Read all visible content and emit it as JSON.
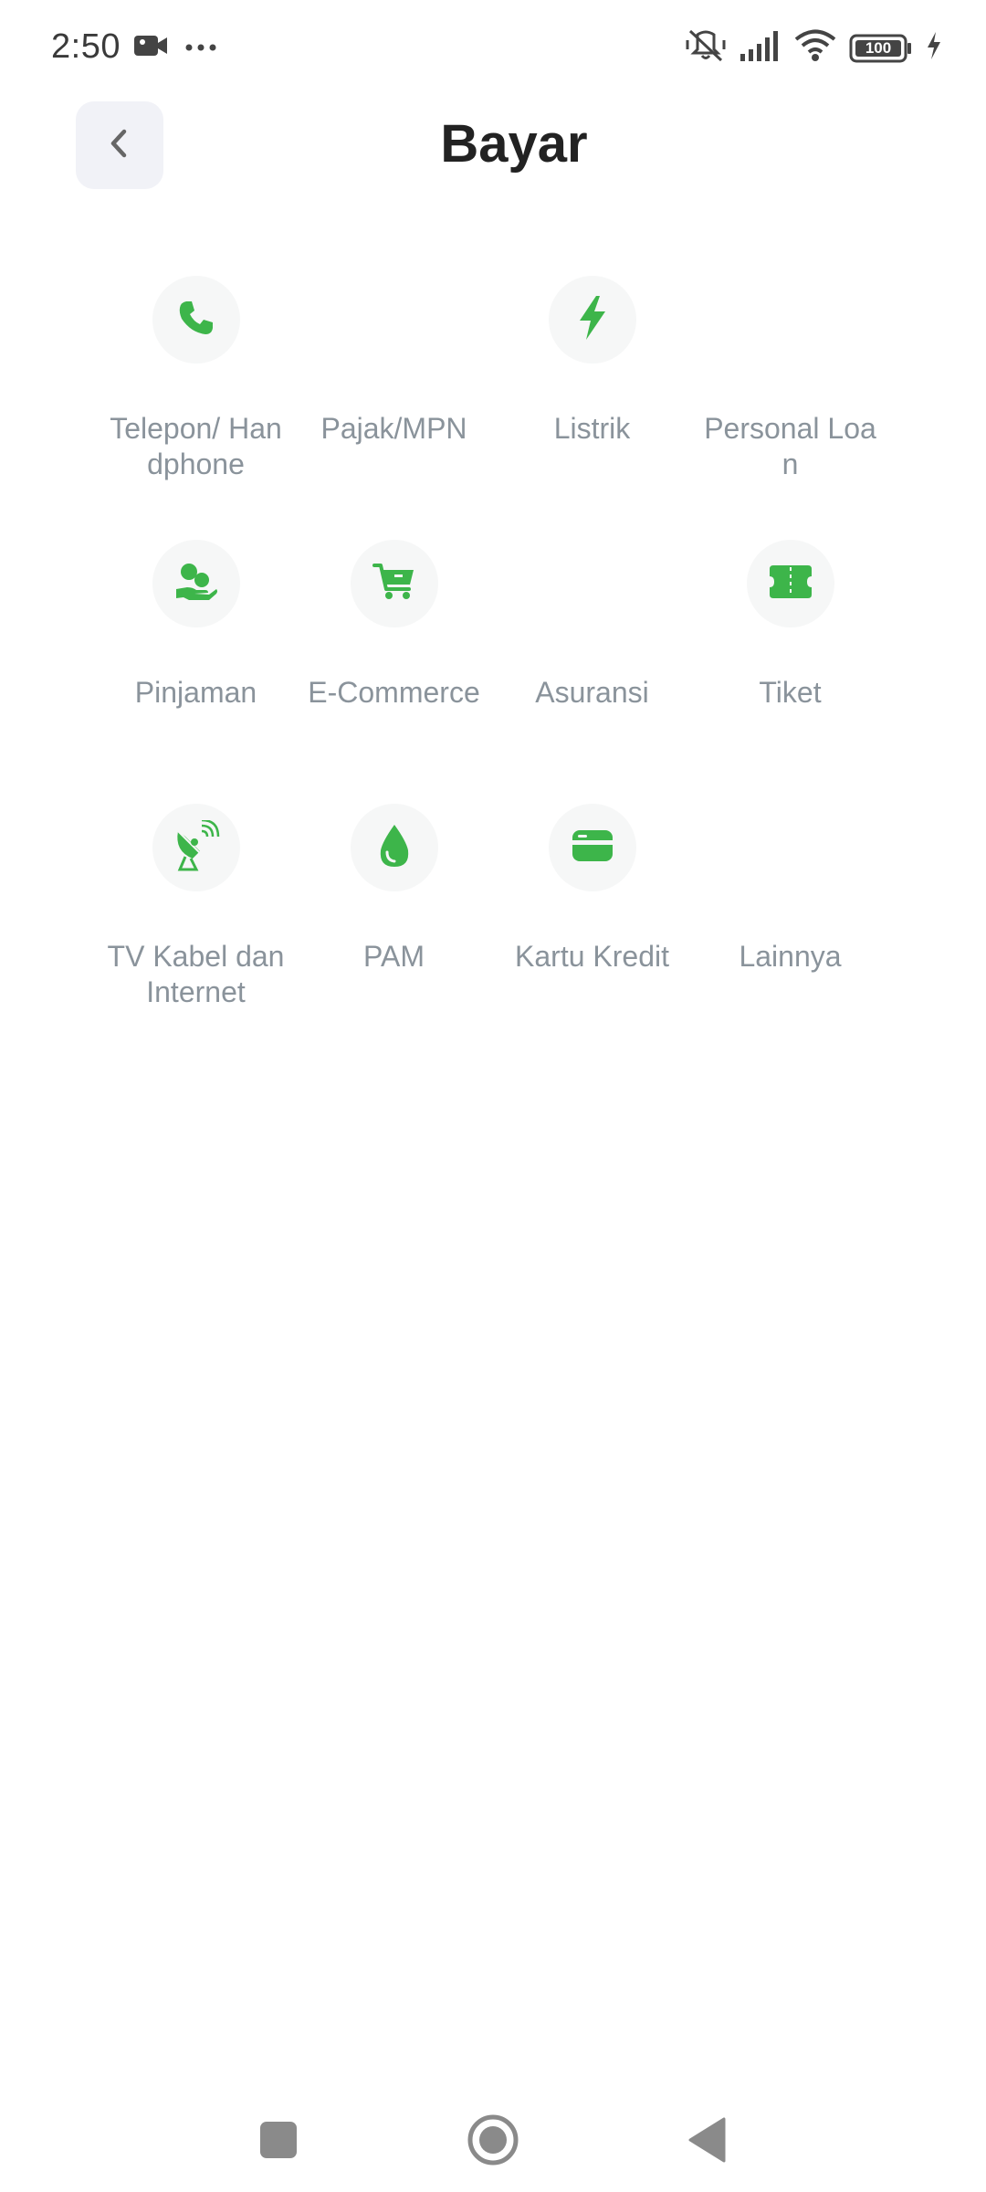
{
  "status_bar": {
    "time": "2:50",
    "battery": "100",
    "icons": [
      "video-camera-icon",
      "more-dots-icon",
      "mute-icon",
      "signal-icon",
      "wifi-icon",
      "battery-icon",
      "charging-icon"
    ]
  },
  "header": {
    "title": "Bayar",
    "back_icon": "chevron-left-icon"
  },
  "colors": {
    "accent": "#3db54a",
    "label": "#8a939b",
    "icon_bg": "#f6f7f7"
  },
  "menu": [
    {
      "label": "Telepon/ Handphone",
      "icon": "phone-icon"
    },
    {
      "label": "Pajak/MPN",
      "icon": ""
    },
    {
      "label": "Listrik",
      "icon": "lightning-icon"
    },
    {
      "label": "Personal Loan",
      "icon": ""
    },
    {
      "label": "Pinjaman",
      "icon": "loan-hand-icon"
    },
    {
      "label": "E-Commerce",
      "icon": "cart-icon"
    },
    {
      "label": "Asuransi",
      "icon": ""
    },
    {
      "label": "Tiket",
      "icon": "ticket-icon"
    },
    {
      "label": "TV Kabel dan Internet",
      "icon": "satellite-dish-icon"
    },
    {
      "label": "PAM",
      "icon": "water-drop-icon"
    },
    {
      "label": "Kartu Kredit",
      "icon": "credit-card-icon"
    },
    {
      "label": "Lainnya",
      "icon": ""
    }
  ],
  "nav_bar": {
    "icons": [
      "recent-apps-icon",
      "home-icon",
      "back-icon"
    ]
  }
}
